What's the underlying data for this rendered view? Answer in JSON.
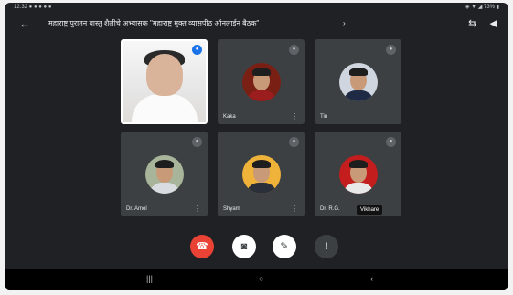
{
  "status_bar": {
    "left": "12:32 ● ● ● ● ●",
    "right": "◈ ▼ ◢ 73% ▮"
  },
  "app_bar": {
    "back_icon": "←",
    "title": "महाराष्ट्र पुरातन वास्तु शैलीचे अभ्यासक \"महाराष्ट्र मुक्त व्यासपीठ ऑनलाईन बैठक\"",
    "title_chevron": "›",
    "switch_camera_icon": "⇆",
    "volume_icon": "◀"
  },
  "participants": [
    {
      "name": "",
      "featured": true,
      "speaking_badge": "●"
    },
    {
      "name": "Kaka",
      "more": "⋮",
      "mute": "●",
      "bg": "#7a1f14",
      "shirt": "#9b1d1d"
    },
    {
      "name": "Tin",
      "more": "",
      "mute": "●",
      "bg": "#cfd6df",
      "shirt": "#1f2b44"
    },
    {
      "name": "Dr. Amol",
      "more": "⋮",
      "mute": "●",
      "bg": "#a9b59a",
      "shirt": "#d9dde2"
    },
    {
      "name": "Shyam",
      "more": "⋮",
      "mute": "●",
      "bg": "#f0b33a",
      "shirt": "#2b2f3a"
    },
    {
      "name": "Dr. R.G.",
      "more": "",
      "mute": "●",
      "bg": "#c31d1d",
      "shirt": "#e8e8e8",
      "tag": "Vikhare"
    }
  ],
  "controls": {
    "end_call_icon": "☎",
    "camera_icon": "◙",
    "mic_icon": "✎",
    "more_icon": "!"
  },
  "nav_bar": {
    "recents": "|||",
    "home": "○",
    "back": "‹"
  }
}
